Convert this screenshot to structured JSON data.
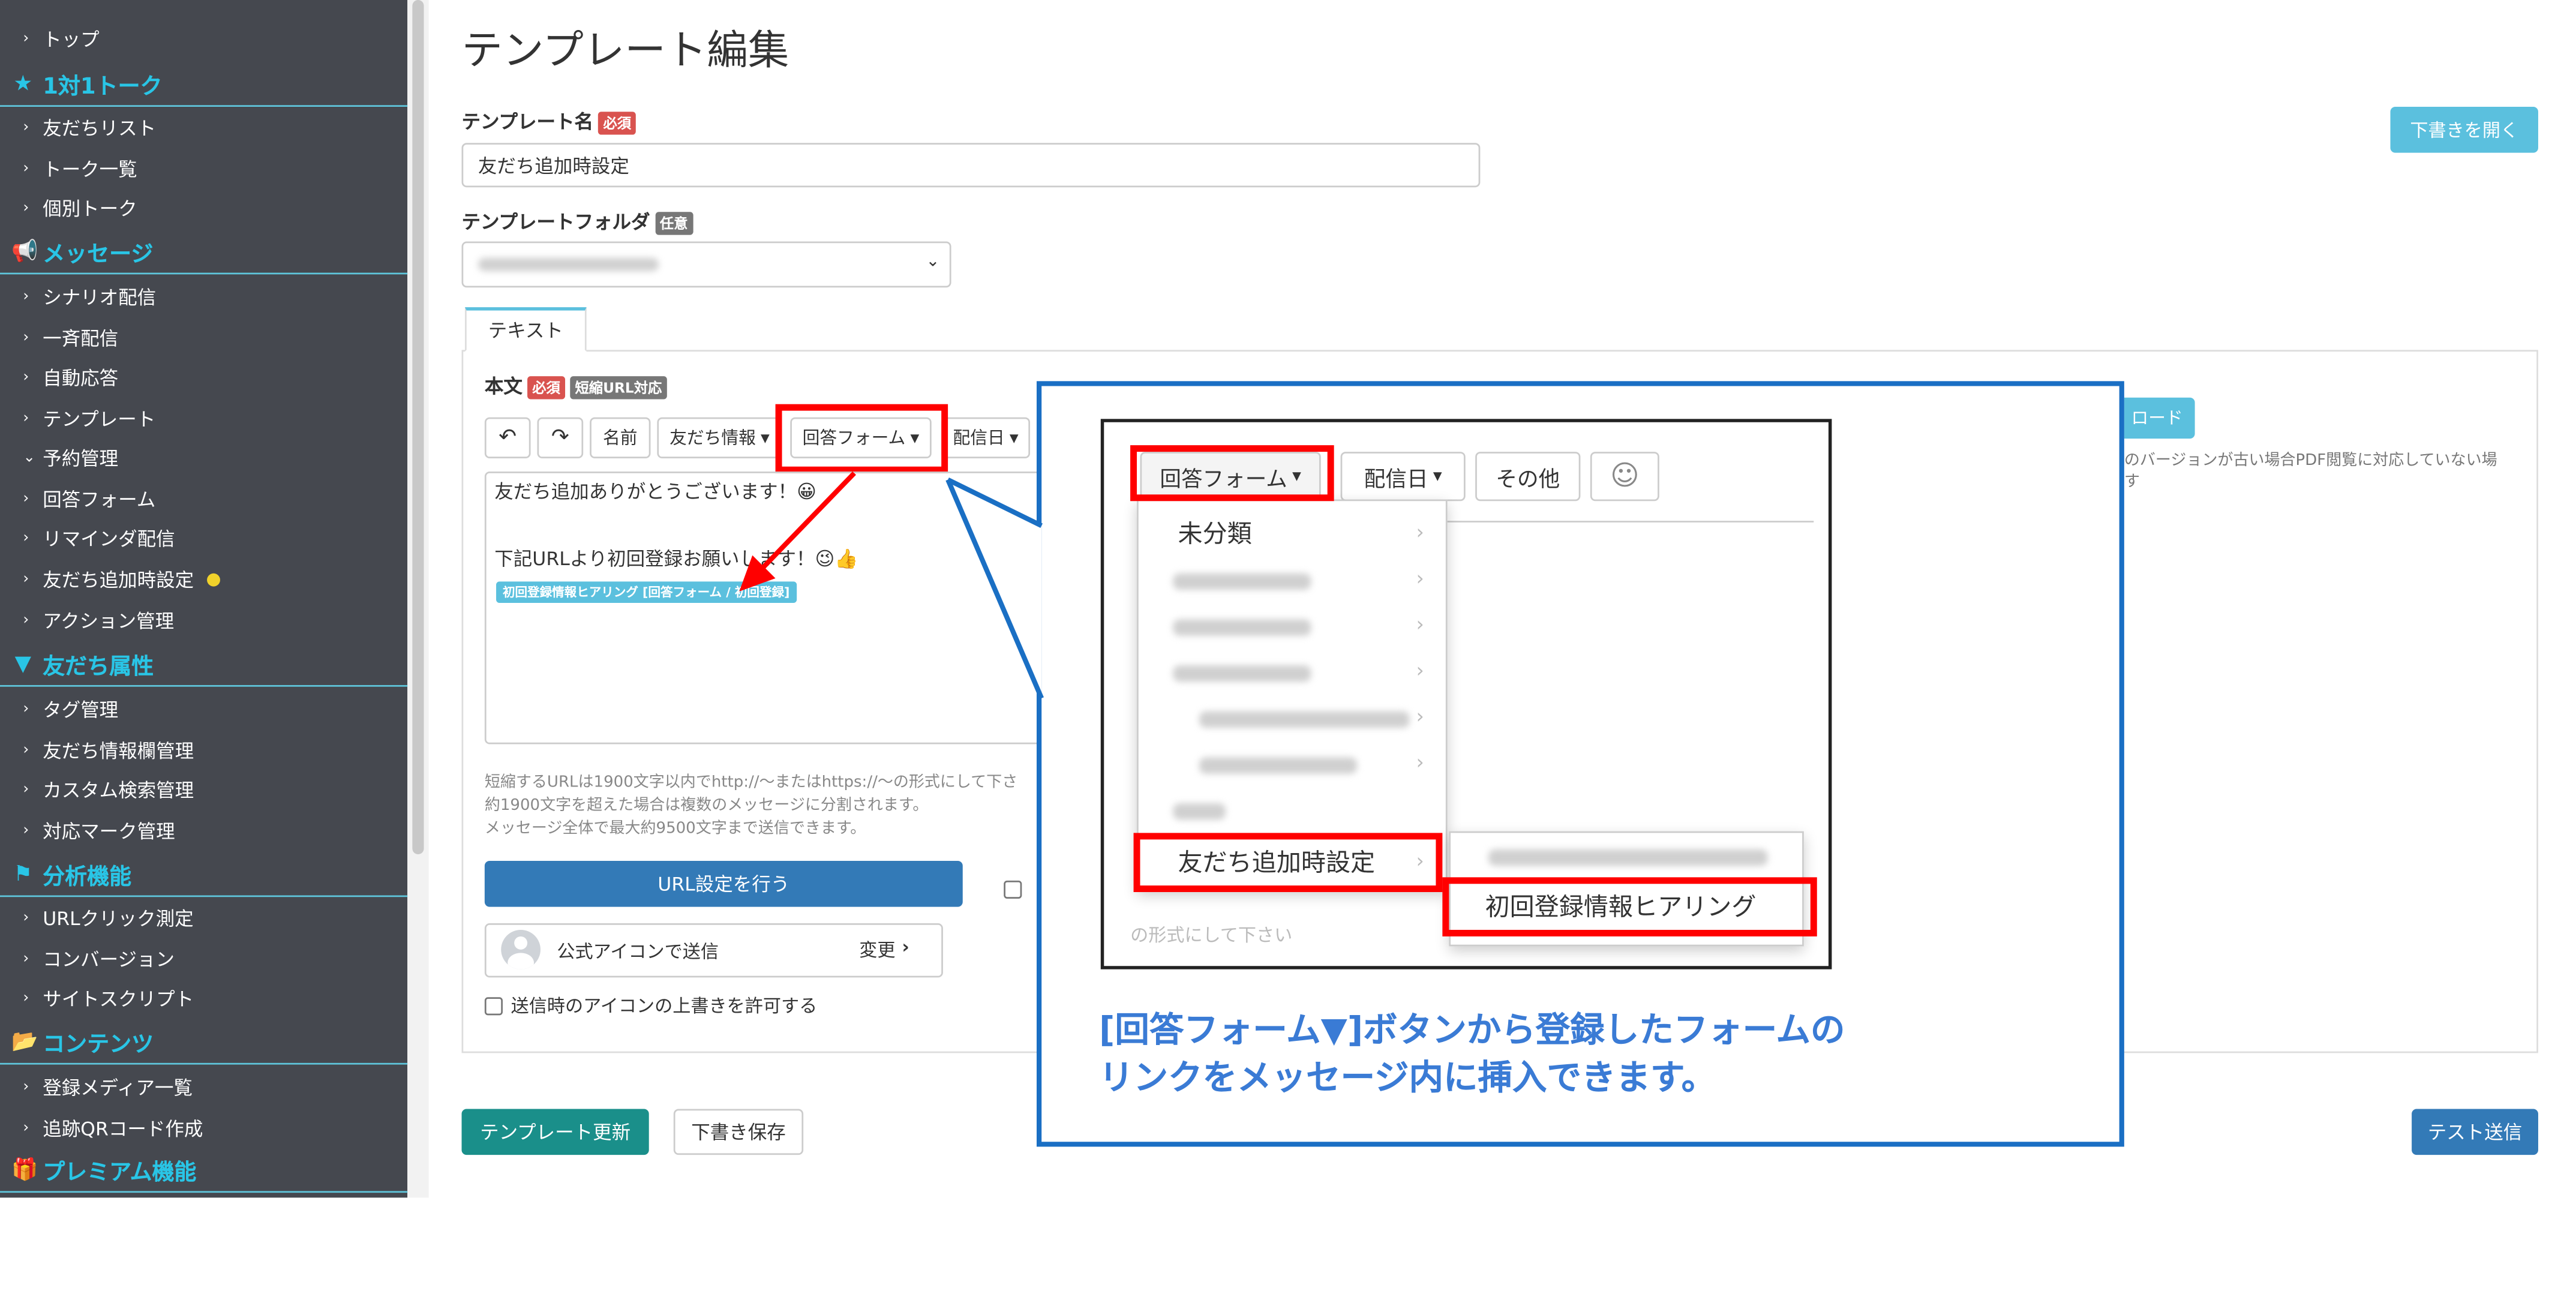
{
  "sidebar": {
    "items": [
      {
        "type": "item",
        "label": "トップ"
      },
      {
        "type": "section",
        "label": "1対1トーク",
        "icon": "star-icon"
      },
      {
        "type": "item",
        "label": "友だちリスト"
      },
      {
        "type": "item",
        "label": "トーク一覧"
      },
      {
        "type": "item",
        "label": "個別トーク"
      },
      {
        "type": "section",
        "label": "メッセージ",
        "icon": "megaphone-icon"
      },
      {
        "type": "item",
        "label": "シナリオ配信"
      },
      {
        "type": "item",
        "label": "一斉配信"
      },
      {
        "type": "item",
        "label": "自動応答"
      },
      {
        "type": "item",
        "label": "テンプレート"
      },
      {
        "type": "item",
        "label": "予約管理",
        "expanded": true
      },
      {
        "type": "item",
        "label": "回答フォーム"
      },
      {
        "type": "item",
        "label": "リマインダ配信"
      },
      {
        "type": "item",
        "label": "友だち追加時設定",
        "dot": true
      },
      {
        "type": "item",
        "label": "アクション管理"
      },
      {
        "type": "section",
        "label": "友だち属性",
        "icon": "filter-icon"
      },
      {
        "type": "item",
        "label": "タグ管理"
      },
      {
        "type": "item",
        "label": "友だち情報欄管理"
      },
      {
        "type": "item",
        "label": "カスタム検索管理"
      },
      {
        "type": "item",
        "label": "対応マーク管理"
      },
      {
        "type": "section",
        "label": "分析機能",
        "icon": "flag-icon"
      },
      {
        "type": "item",
        "label": "URLクリック測定"
      },
      {
        "type": "item",
        "label": "コンバージョン"
      },
      {
        "type": "item",
        "label": "サイトスクリプト"
      },
      {
        "type": "section",
        "label": "コンテンツ",
        "icon": "folder-icon"
      },
      {
        "type": "item",
        "label": "登録メディア一覧"
      },
      {
        "type": "item",
        "label": "追跡QRコード作成"
      },
      {
        "type": "section",
        "label": "プレミアム機能",
        "icon": "gift-icon"
      }
    ]
  },
  "page": {
    "title": "テンプレート編集",
    "open_draft_button": "下書きを開く",
    "template_name_label": "テンプレート名",
    "required_badge": "必須",
    "template_name_value": "友だち追加時設定",
    "folder_label": "テンプレートフォルダ",
    "optional_badge": "任意",
    "tab_text": "テキスト",
    "body_label": "本文",
    "short_url_badge": "短縮URL対応",
    "toolbar": {
      "undo_icon": "undo-icon",
      "redo_icon": "redo-icon",
      "name": "名前",
      "friend_info": "友だち情報",
      "answer_form": "回答フォーム",
      "delivery_date": "配信日"
    },
    "message": {
      "line1": "友だち追加ありがとうございます！😀",
      "line2": "下記URLより初回登録お願いします！😉👍",
      "chip": "初回登録情報ヒアリング [回答フォーム / 初回登録]"
    },
    "help": {
      "line1": "短縮するURLは1900文字以内でhttp://〜またはhttps://〜の形式にして下さ",
      "line2": "約1900文字を超えた場合は複数のメッセージに分割されます。",
      "line3": "メッセージ全体で最大約9500文字まで送信できます。"
    },
    "url_button": "URL設定を行う",
    "icon_row_label": "公式アイコンで送信",
    "change_label": "変更",
    "overwrite_label": "送信時のアイコンの上書きを許可する",
    "right_button_partial": "ロード",
    "right_note": "のバージョンが古い場合PDF閲覧に対応していない場",
    "right_note2": "す",
    "update_button": "テンプレート更新",
    "draft_save_button": "下書き保存",
    "test_send_button": "テスト送信"
  },
  "callout": {
    "toolbar_answer_form": "回答フォーム",
    "toolbar_delivery_date": "配信日",
    "toolbar_other": "その他",
    "menu_uncategorized": "未分類",
    "menu_selected": "友だち追加時設定",
    "submenu_selected": "初回登録情報ヒアリング",
    "bottom_fragment": "の形式にして下さい",
    "caption_line1": "[回答フォーム▼]ボタンから登録したフォームの",
    "caption_line2": "リンクをメッセージ内に挿入できます。"
  },
  "colors": {
    "sidebar_bg": "#45484f",
    "sidebar_section": "#29c5e6",
    "primary_teal": "#1a8f8a",
    "primary_blue": "#337ab7",
    "info_button": "#5bc0de",
    "highlight_red": "#ff0000",
    "callout_border": "#1a6fc4",
    "caption_text": "#3a7bd5"
  }
}
